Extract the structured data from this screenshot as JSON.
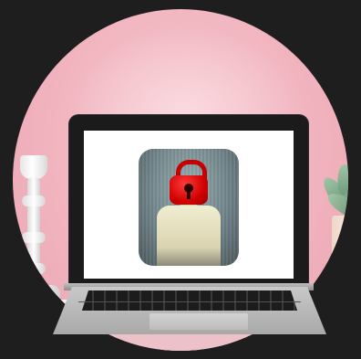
{
  "scene": {
    "subject": "laptop-with-locked-user-icon",
    "icons": [
      "lock-icon",
      "user-silhouette-icon"
    ],
    "colors": {
      "background": "#1e1e1e",
      "wall": "#f1b4bf",
      "lock": "#d10000",
      "screen": "#ffffff",
      "laptop": "#1b1b1b"
    }
  }
}
